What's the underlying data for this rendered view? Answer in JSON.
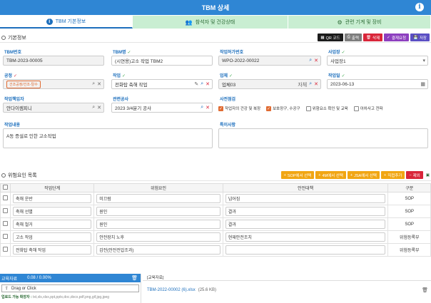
{
  "window": {
    "title": "TBM 상세"
  },
  "tabs": [
    {
      "label": "TBM 기본정보",
      "icon": "info-icon"
    },
    {
      "label": "참석자 및 건강상태",
      "icon": "people-icon"
    },
    {
      "label": "관련 기계 및 장비",
      "icon": "machine-icon"
    }
  ],
  "basic": {
    "section_title": "기본정보",
    "buttons": {
      "qr": "QR 코드",
      "print": "출력",
      "delete": "삭제",
      "approval": "결재요청",
      "save": "저장"
    }
  },
  "form": {
    "tbm_no_label": "TBM번호",
    "tbm_no": "TBM-2023-00005",
    "tbm_name_label": "TBM명",
    "tbm_name": "(시연용)고소 작업 TBM2",
    "permit_label": "작업허가번호",
    "permit": "WPO-2022-00022",
    "site_label": "사업장",
    "site": "사업장1",
    "process_label": "공정",
    "process": "건조공정/건조-탈수",
    "work_label": "작업",
    "work": "전화탑 축해 작업",
    "vendor_label": "업체",
    "vendor": "업체03",
    "vendor_type": "자체",
    "date_label": "작업일",
    "date": "2023-06-13",
    "manager_label": "작업책임자",
    "manager": "안다이렘피니",
    "project_label": "관련공사",
    "project": "2023 3/4분기 공사",
    "precheck_label": "사전점검",
    "precheck": [
      {
        "label": "작업자의 건강 및 복장",
        "checked": true
      },
      {
        "label": "보호장구, 수공구",
        "checked": true
      },
      {
        "label": "위험요소 확인 및 교육",
        "checked": false
      },
      {
        "label": "아차사고 전파",
        "checked": false
      }
    ],
    "content_label": "작업내용",
    "content": "A동 증설로 인한 고소작업",
    "remarks_label": "특이사항",
    "remarks": ""
  },
  "hazard": {
    "section_title": "위험요인 목록",
    "buttons": {
      "sop": "SOP에서 선택",
      "m4": "4M에서 선택",
      "jsa": "JSA에서 선택",
      "direct": "직접추가",
      "remove": "제외"
    },
    "columns": [
      "작업단계",
      "위험요인",
      "안전대책",
      "구분"
    ],
    "rows": [
      {
        "step": "축해 운반",
        "risk": "미끄럼",
        "measure": "넘어짐",
        "type": "SOP"
      },
      {
        "step": "축해 선별",
        "risk": "원인",
        "measure": "결과",
        "type": "SOP"
      },
      {
        "step": "축해 철거",
        "risk": "원인",
        "measure": "결과",
        "type": "SOP"
      },
      {
        "step": "고소 작업",
        "risk": "안전장치 노후",
        "measure": "현재안전조치",
        "type": "위험등록부"
      },
      {
        "step": "전화탑 축해 작업",
        "risk": "감전(안전전압조과)",
        "measure": "",
        "type": "위험등록부"
      }
    ]
  },
  "attachments": {
    "title": "교육자료",
    "size": "0.08 / 0.00%",
    "drop_label": "Drag or Click",
    "allowed_label": "업로드 가능 확장자 :",
    "allowed": "txt,xls,xlsx,ppt,pptx,doc,docx,pdf,png,gif,jpg,jpeg",
    "list_title": "[교육자료]",
    "file_name": "TBM-2022-00002 (6).xlsx",
    "file_size": "(25.6 KB)"
  }
}
